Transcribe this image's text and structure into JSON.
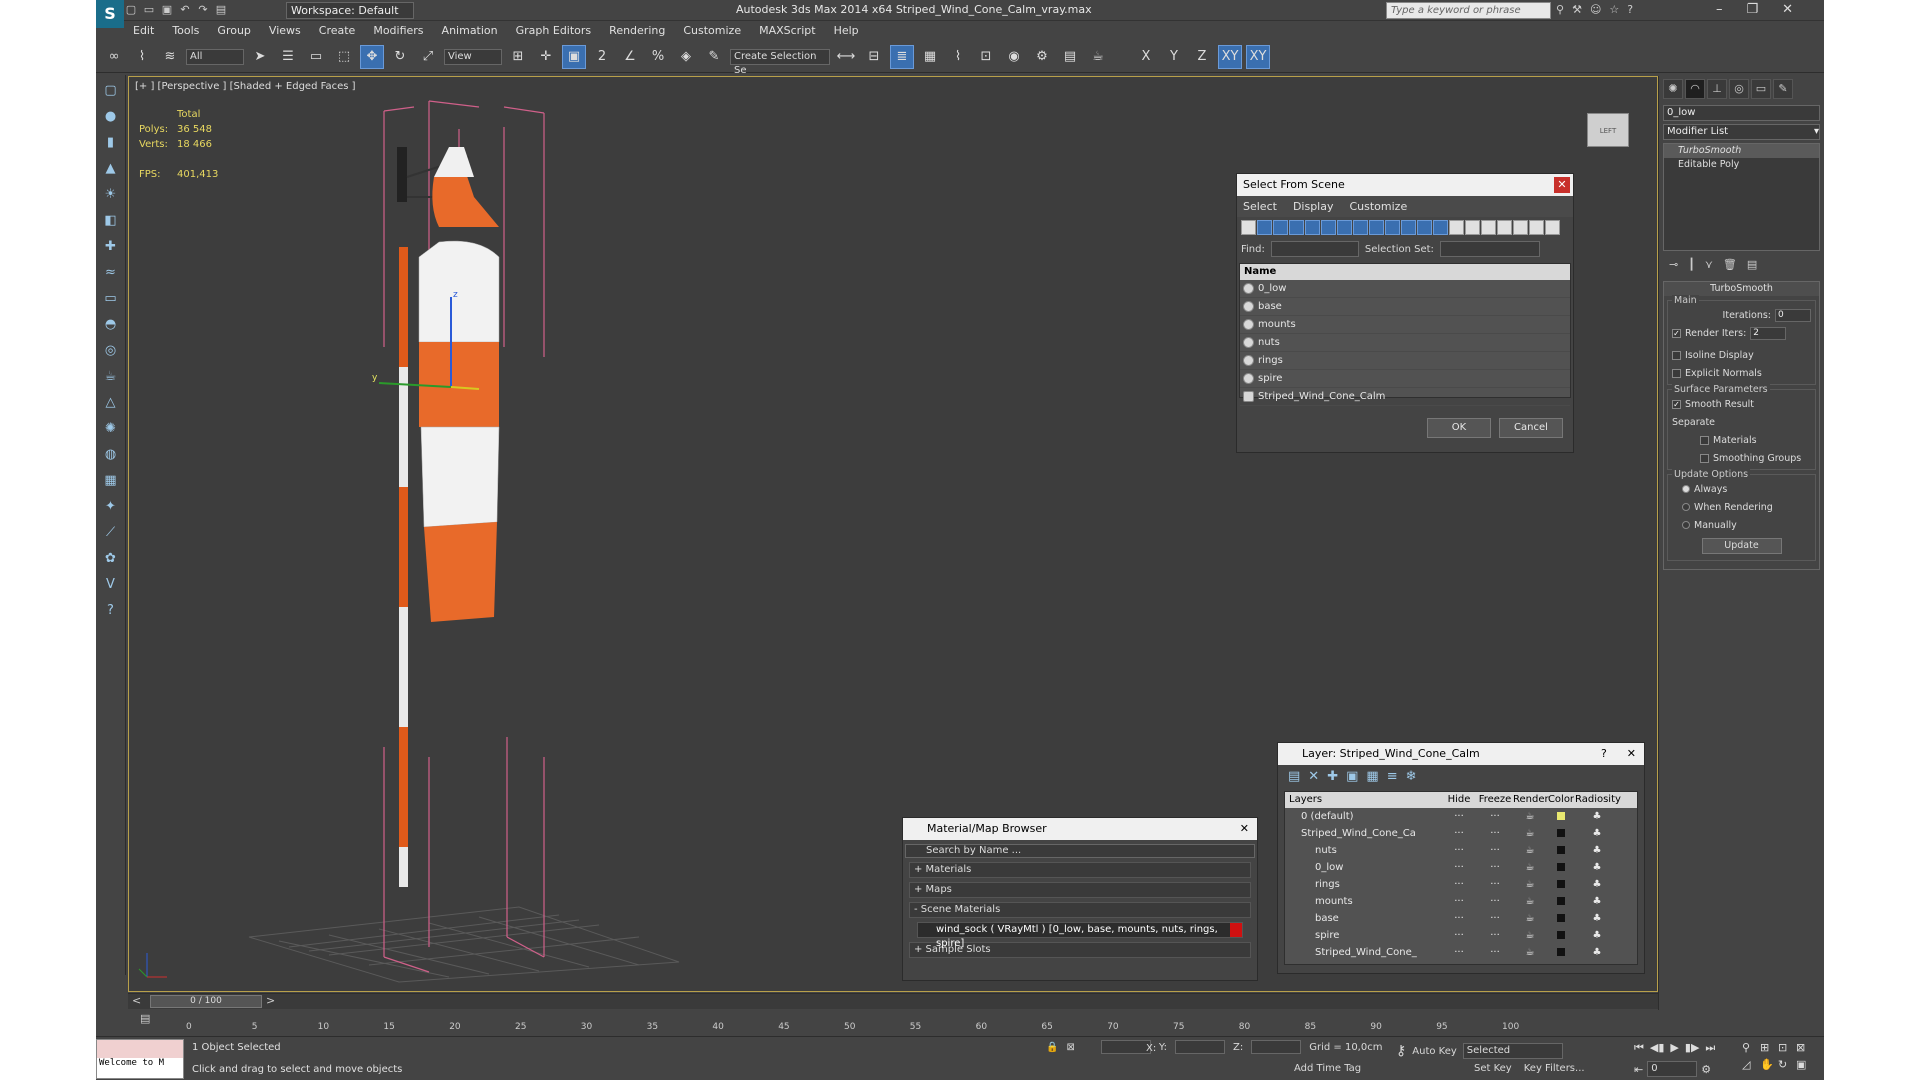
{
  "window": {
    "title": "Autodesk 3ds Max  2014 x64    Striped_Wind_Cone_Calm_vray.max",
    "workspace": "Workspace: Default",
    "search_placeholder": "Type a keyword or phrase"
  },
  "menu": [
    "Edit",
    "Tools",
    "Group",
    "Views",
    "Create",
    "Modifiers",
    "Animation",
    "Graph Editors",
    "Rendering",
    "Customize",
    "MAXScript",
    "Help"
  ],
  "toolbar": {
    "filter": "All",
    "refcoord": "View",
    "selset": "Create Selection Se"
  },
  "viewport": {
    "label": "[+ ] [Perspective ] [Shaded + Edged Faces ]",
    "stats": {
      "total": "Total",
      "polys_label": "Polys:",
      "polys": "36 548",
      "verts_label": "Verts:",
      "verts": "18 466",
      "fps_label": "FPS:",
      "fps": "401,413"
    }
  },
  "select_from_scene": {
    "title": "Select From Scene",
    "menu": [
      "Select",
      "Display",
      "Customize"
    ],
    "find_label": "Find:",
    "selset_label": "Selection Set:",
    "col_name": "Name",
    "items": [
      "0_low",
      "base",
      "mounts",
      "nuts",
      "rings",
      "spire",
      "Striped_Wind_Cone_Calm"
    ],
    "ok": "OK",
    "cancel": "Cancel"
  },
  "command_panel": {
    "object_name": "0_low",
    "modifier_list": "Modifier List",
    "stack": [
      "TurboSmooth",
      "Editable Poly"
    ],
    "rollout_title": "TurboSmooth",
    "main_label": "Main",
    "iterations_label": "Iterations:",
    "iterations": "0",
    "render_iters_label": "Render Iters:",
    "render_iters": "2",
    "isoline": "Isoline Display",
    "explicit_normals": "Explicit Normals",
    "surface_params": "Surface Parameters",
    "smooth_result": "Smooth Result",
    "separate": "Separate",
    "materials": "Materials",
    "smoothing_groups": "Smoothing Groups",
    "update_options": "Update Options",
    "always": "Always",
    "when_rendering": "When Rendering",
    "manually": "Manually",
    "update": "Update"
  },
  "material_browser": {
    "title": "Material/Map Browser",
    "search_placeholder": "Search by Name ...",
    "sections": [
      "+ Materials",
      "+ Maps",
      "- Scene Materials"
    ],
    "material": "wind_sock  ( VRayMtl ) [0_low, base, mounts, nuts, rings, spire]",
    "sample_slots": "+ Sample Slots"
  },
  "layer_dialog": {
    "title": "Layer: Striped_Wind_Cone_Calm",
    "help": "?",
    "columns": [
      "Layers",
      "Hide",
      "Freeze",
      "Render",
      "Color",
      "Radiosity"
    ],
    "rows": [
      "0 (default)",
      "Striped_Wind_Cone_Ca",
      "nuts",
      "0_low",
      "rings",
      "mounts",
      "base",
      "spire",
      "Striped_Wind_Cone_"
    ]
  },
  "timeline": {
    "slider": "0 / 100",
    "ticks": [
      "0",
      "5",
      "10",
      "15",
      "20",
      "25",
      "30",
      "35",
      "40",
      "45",
      "50",
      "55",
      "60",
      "65",
      "70",
      "75",
      "80",
      "85",
      "90",
      "95",
      "100"
    ]
  },
  "status": {
    "welcome": "Welcome to M",
    "selected": "1 Object Selected",
    "prompt": "Click and drag to select and move objects",
    "x_label": "X:",
    "y_label": "Y:",
    "z_label": "Z:",
    "grid": "Grid = 10,0cm",
    "add_time_tag": "Add Time Tag",
    "auto_key": "Auto Key",
    "selected_mode": "Selected",
    "set_key": "Set Key",
    "key_filters": "Key Filters...",
    "frame": "0"
  }
}
